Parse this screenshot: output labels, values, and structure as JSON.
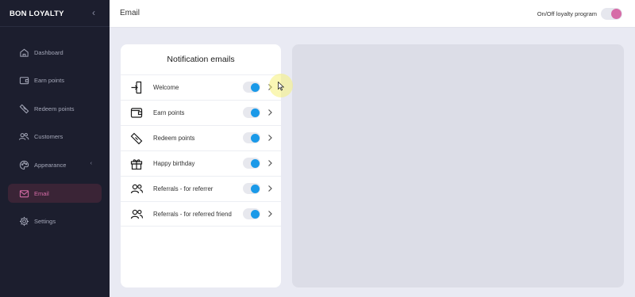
{
  "app": {
    "brand": "BON LOYALTY"
  },
  "sidebar": {
    "items": [
      {
        "label": "Dashboard",
        "icon": "home-icon"
      },
      {
        "label": "Earn points",
        "icon": "wallet-icon"
      },
      {
        "label": "Redeem points",
        "icon": "ticket-icon"
      },
      {
        "label": "Customers",
        "icon": "users-icon"
      },
      {
        "label": "Appearance",
        "icon": "palette-icon"
      },
      {
        "label": "Email",
        "icon": "mail-icon",
        "active": true
      },
      {
        "label": "Settings",
        "icon": "gear-icon"
      }
    ]
  },
  "header": {
    "title": "Email",
    "toggle_label": "On/Off loyalty program",
    "toggle_on": true
  },
  "notifications": {
    "heading": "Notification emails",
    "items": [
      {
        "label": "Welcome",
        "icon": "door-enter-icon",
        "enabled": true
      },
      {
        "label": "Earn points",
        "icon": "wallet-icon",
        "enabled": true
      },
      {
        "label": "Redeem points",
        "icon": "ticket-icon",
        "enabled": true
      },
      {
        "label": "Happy birthday",
        "icon": "gift-icon",
        "enabled": true
      },
      {
        "label": "Referrals - for referrer",
        "icon": "users-icon",
        "enabled": true
      },
      {
        "label": "Referrals - for referred friend",
        "icon": "users-icon",
        "enabled": true
      }
    ]
  },
  "colors": {
    "sidebar_bg": "#1c1e2e",
    "accent_pink": "#d66ca7",
    "toggle_blue": "#1a99e8",
    "content_bg": "#e9eaf3"
  }
}
